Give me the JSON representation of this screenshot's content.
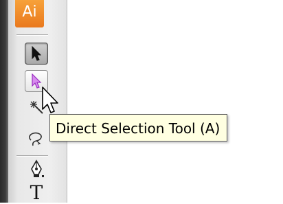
{
  "app": {
    "logo_text": "Ai",
    "brand_color": "#f08a24"
  },
  "tools": [
    {
      "name": "Selection Tool",
      "icon": "black-arrow-icon",
      "state": "selected"
    },
    {
      "name": "Direct Selection Tool",
      "icon": "white-arrow-icon",
      "state": "hovered"
    },
    {
      "name": "Magic Wand Tool",
      "icon": "magic-wand-icon"
    },
    {
      "name": "Lasso Tool",
      "icon": "lasso-icon"
    },
    {
      "name": "Pen Tool",
      "icon": "pen-icon"
    },
    {
      "name": "Type Tool",
      "icon": "type-icon",
      "glyph": "T"
    }
  ],
  "tooltip": {
    "text": "Direct Selection Tool (A)"
  },
  "colors": {
    "tooltip_bg": "#ffffe1",
    "direct_select_accent": "#b04ad0"
  }
}
